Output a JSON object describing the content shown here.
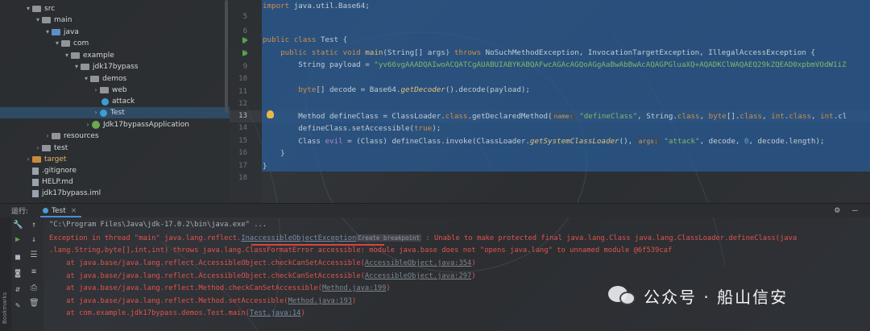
{
  "project_tree": {
    "items": [
      {
        "label": "src",
        "type": "folder"
      },
      {
        "label": "main",
        "type": "folder"
      },
      {
        "label": "java",
        "type": "folder"
      },
      {
        "label": "com",
        "type": "package"
      },
      {
        "label": "example",
        "type": "package"
      },
      {
        "label": "jdk17bypass",
        "type": "package"
      },
      {
        "label": "demos",
        "type": "package"
      },
      {
        "label": "web",
        "type": "package"
      },
      {
        "label": "attack",
        "type": "class"
      },
      {
        "label": "Test",
        "type": "class"
      },
      {
        "label": "Jdk17bypassApplication",
        "type": "class"
      },
      {
        "label": "resources",
        "type": "folder"
      },
      {
        "label": "test",
        "type": "folder"
      },
      {
        "label": "target",
        "type": "folder"
      },
      {
        "label": ".gitignore",
        "type": "file"
      },
      {
        "label": "HELP.md",
        "type": "file"
      },
      {
        "label": "jdk17bypass.iml",
        "type": "file"
      }
    ]
  },
  "editor": {
    "line_numbers": [
      "5",
      "6",
      "7",
      "8",
      "9",
      "10",
      "11",
      "12",
      "13",
      "14",
      "15",
      "16",
      "17",
      "18"
    ],
    "code": {
      "l5_import_prefix": "import ",
      "l5_import_text": "java.util.Base64;",
      "l7_public": "public ",
      "l7_class": "class ",
      "l7_name": "Test {",
      "l8_indent": "    ",
      "l8_mods": "public static void ",
      "l8_main": "main",
      "l8_params": "(String[] args) ",
      "l8_throws": "throws ",
      "l8_exc": "NoSuchMethodException, InvocationTargetException, IllegalAccessException {",
      "l9_decl": "        String payload = ",
      "l9_str": "\"yv66vgAAADQAIwoACQATCgAUABUIABYKABQAFwcAGAcAGQoAGgAaBwAbBwAcAQAGPGluaXQ+AQADKClWAQAEQ29kZQEAD0xpbmVOdW1iZ",
      "l11_kw": "        byte",
      "l11_rest": "[] decode = Base64.",
      "l11_call": "getDecoder",
      "l11_rest2": "().decode(payload);",
      "l13_a": "        Method defineClass = ClassLoader.",
      "l13_kw": "class",
      "l13_b": ".getDeclaredMethod(",
      "l13_hint": "name:",
      "l13_str": " \"defineClass\"",
      "l13_c": ", String.",
      "l13_kw2": "class",
      "l13_d": ", ",
      "l13_kw3": "byte",
      "l13_e": "[].",
      "l13_kw4": "class",
      "l13_f": ", ",
      "l13_kw5": "int",
      "l13_g": ".",
      "l13_kw6": "class",
      "l13_h": ", ",
      "l13_kw7": "int",
      "l13_i": ".cl",
      "l14_a": "        defineClass.setAccessible(",
      "l14_kw": "true",
      "l14_b": ");",
      "l15_a": "        Class ",
      "l15_var": "evil",
      "l15_b": " = (Class) defineClass.invoke(ClassLoader.",
      "l15_call": "getSystemClassLoader",
      "l15_c": "(), ",
      "l15_hint": "args:",
      "l15_str": " \"attack\"",
      "l15_d": ", decode, ",
      "l15_num": "0",
      "l15_e": ", decode.length);",
      "l16": "    }",
      "l17": "}"
    }
  },
  "run_panel": {
    "label": "运行:",
    "tab": "Test",
    "tab_close": "×",
    "gear": "⚙",
    "minimize": "—",
    "side_label": "Bookmarks",
    "console": {
      "cmd": "\"C:\\Program Files\\Java\\jdk-17.0.2\\bin\\java.exe\" ...",
      "e1_a": "Exception in thread \"main\" java.lang.reflect.",
      "e1_link": "InaccessibleObjectException",
      "e1_cb": "Create breakpoint",
      "e1_b": " : Unable to make protected final java.lang.Class java.lang.ClassLoader.defineClass(java",
      "e2": ".lang.String,byte[],int,int) throws java.lang.ClassFormatError accessible: module java.base does not \"opens java.lang\" to unnamed module @6f539caf",
      "s1_a": "    at java.base/java.lang.reflect.AccessibleObject.checkCanSetAccessible(",
      "s1_link": "AccessibleObject.java:354",
      "s1_b": ")",
      "s2_a": "    at java.base/java.lang.reflect.AccessibleObject.checkCanSetAccessible(",
      "s2_link": "AccessibleObject.java:297",
      "s2_b": ")",
      "s3_a": "    at java.base/java.lang.reflect.Method.checkCanSetAccessible(",
      "s3_link": "Method.java:199",
      "s3_b": ")",
      "s4_a": "    at java.base/java.lang.reflect.Method.setAccessible(",
      "s4_link": "Method.java:193",
      "s4_b": ")",
      "s5_a": "    at com.example.jdk17bypass.demos.Test.main(",
      "s5_link": "Test.java:14",
      "s5_b": ")"
    }
  },
  "watermark": {
    "text": "公众号 · 船山信安",
    "icon": "wechat-icon"
  },
  "colors": {
    "keyword": "#d08d4b",
    "string": "#7fb869",
    "selection": "#285d98",
    "error": "#e0544f",
    "tree_selection": "#2f4a63"
  }
}
